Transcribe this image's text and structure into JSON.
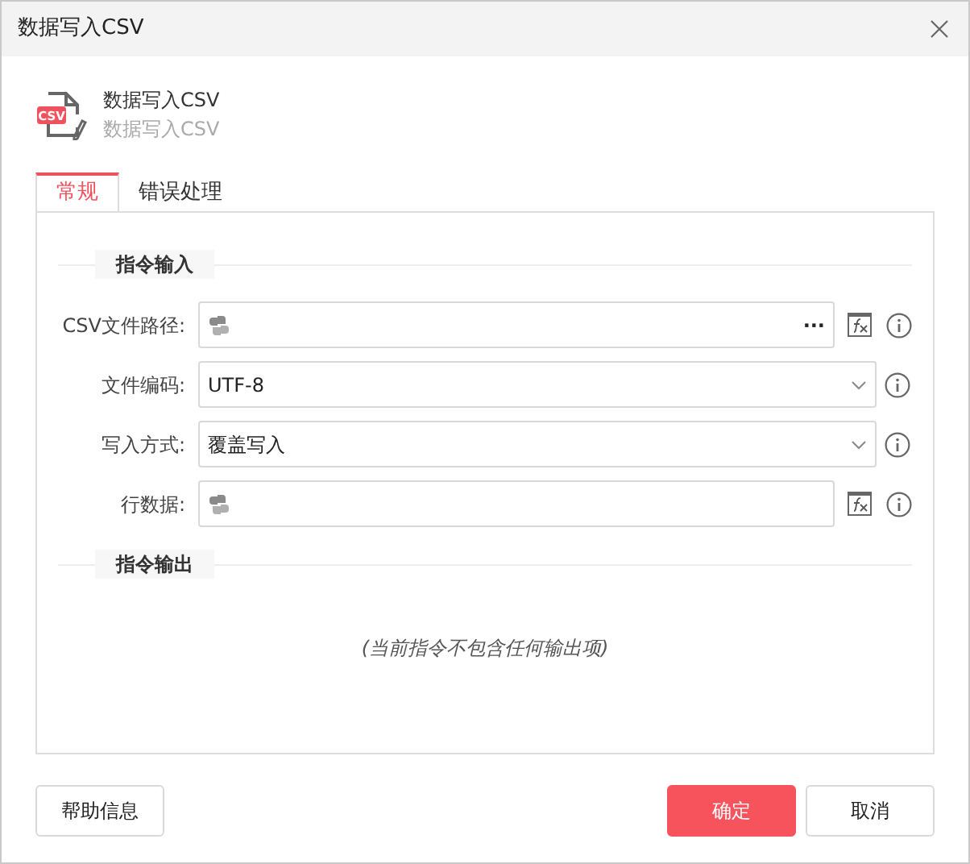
{
  "window": {
    "title": "数据写入CSV"
  },
  "header": {
    "icon_badge": "CSV",
    "title": "数据写入CSV",
    "subtitle": "数据写入CSV"
  },
  "tabs": [
    {
      "label": "常规",
      "selected": true
    },
    {
      "label": "错误处理",
      "selected": false
    }
  ],
  "input_section": {
    "title": "指令输入",
    "fields": [
      {
        "kind": "file",
        "label": "CSV文件路径:",
        "browse": "···"
      },
      {
        "kind": "select",
        "label": "文件编码:",
        "value": "UTF-8"
      },
      {
        "kind": "select",
        "label": "写入方式:",
        "value": "覆盖写入"
      },
      {
        "kind": "expression",
        "label": "行数据:"
      }
    ]
  },
  "output_section": {
    "title": "指令输出",
    "empty_text": "(当前指令不包含任何输出项)"
  },
  "buttons": {
    "help": "帮助信息",
    "ok": "确定",
    "cancel": "取消"
  }
}
